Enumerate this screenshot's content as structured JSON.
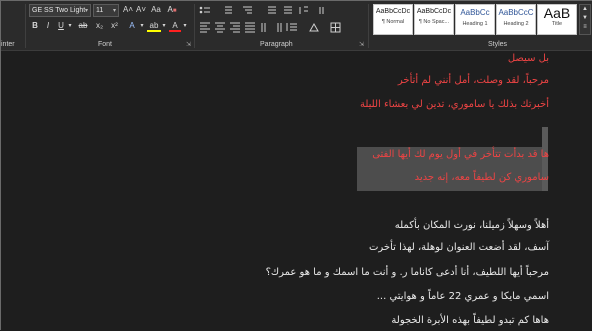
{
  "ribbon": {
    "left_cut_label": "inter",
    "font_name": "GE SS Two Light",
    "font_size": "11",
    "grow_font": "A˄",
    "shrink_font": "A˅",
    "change_case": "Aa",
    "clear_format": "A",
    "bold": "B",
    "italic": "I",
    "underline": "U",
    "strikethrough": "ab",
    "subscript": "x₂",
    "superscript": "x²",
    "font_color_a": "A",
    "highlight": "ab",
    "font_color_b": "A",
    "font_group": "Font",
    "paragraph_group": "Paragraph",
    "styles_group": "Styles",
    "styles": [
      {
        "sample": "AaBbCcDc",
        "name": "¶ Normal"
      },
      {
        "sample": "AaBbCcDc",
        "name": "¶ No Spac..."
      },
      {
        "sample": "AaBbCc",
        "name": "Heading 1"
      },
      {
        "sample": "AaBbCcC",
        "name": "Heading 2"
      },
      {
        "sample": "AaB",
        "name": "Title"
      }
    ]
  },
  "document": {
    "lines": [
      "بل سيصل",
      "مرحباً، لقد وصلت، أمل أنني لم أتأخر",
      "أخبرتك بذلك يا ساموري، تدين لي بعشاء الليلة",
      "ها قد بدأت تتأخر في أول يوم لك أيها الفتى",
      "ساموري كن لطيفاً معه، إنه جديد",
      "أهلاً وسهلاً زميلنا، نورت المكان بأكمله",
      "آسف، لقد أضعت العنوان لوهلة، لهذا تأخرت",
      "مرحباً أيها اللطيف، أنا أدعى كاناما ر. و أنت ما اسمك و ما هو عمرك؟",
      "اسمي مايكا و عمري 22 عاماً و هوايتي ...",
      "هاها كم تبدو لطيفاً بهذه الأبرة الخجولة"
    ]
  },
  "colors": {
    "red_text": "#ee4444",
    "white_text": "#e8e8e8",
    "highlight": "#4d4d4d"
  }
}
